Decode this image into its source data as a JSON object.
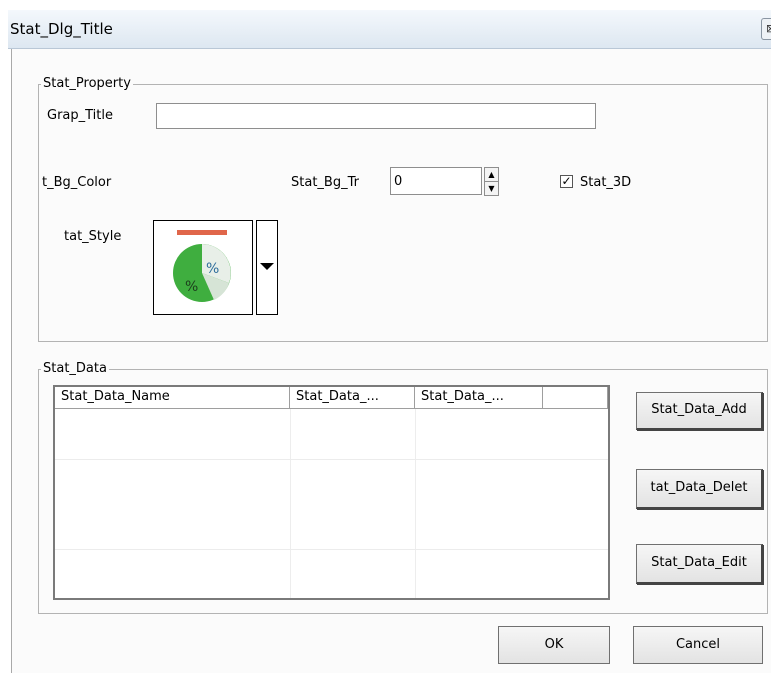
{
  "window": {
    "title": "Stat_Dlg_Title",
    "close_glyph": "⊠"
  },
  "property_group": {
    "legend": "Stat_Property",
    "graph_title_label": "Grap_Title",
    "graph_title_value": "",
    "bg_color_label": "t_Bg_Color",
    "bg_tr_label": "Stat_Bg_Tr",
    "bg_tr_value": "0",
    "three_d_label": "Stat_3D",
    "three_d_checked": true,
    "style_label": "tat_Style",
    "style_icon": "pie-chart-percent-icon"
  },
  "data_group": {
    "legend": "Stat_Data",
    "columns": [
      "Stat_Data_Name",
      "Stat_Data_...",
      "Stat_Data_..."
    ],
    "rows": [],
    "add_label": "Stat_Data_Add",
    "delete_label": "tat_Data_Delet",
    "edit_label": "Stat_Data_Edit"
  },
  "footer": {
    "ok_label": "OK",
    "cancel_label": "Cancel"
  },
  "colors": {
    "pie_green": "#3fae3f",
    "accent_red": "#e0664a"
  }
}
